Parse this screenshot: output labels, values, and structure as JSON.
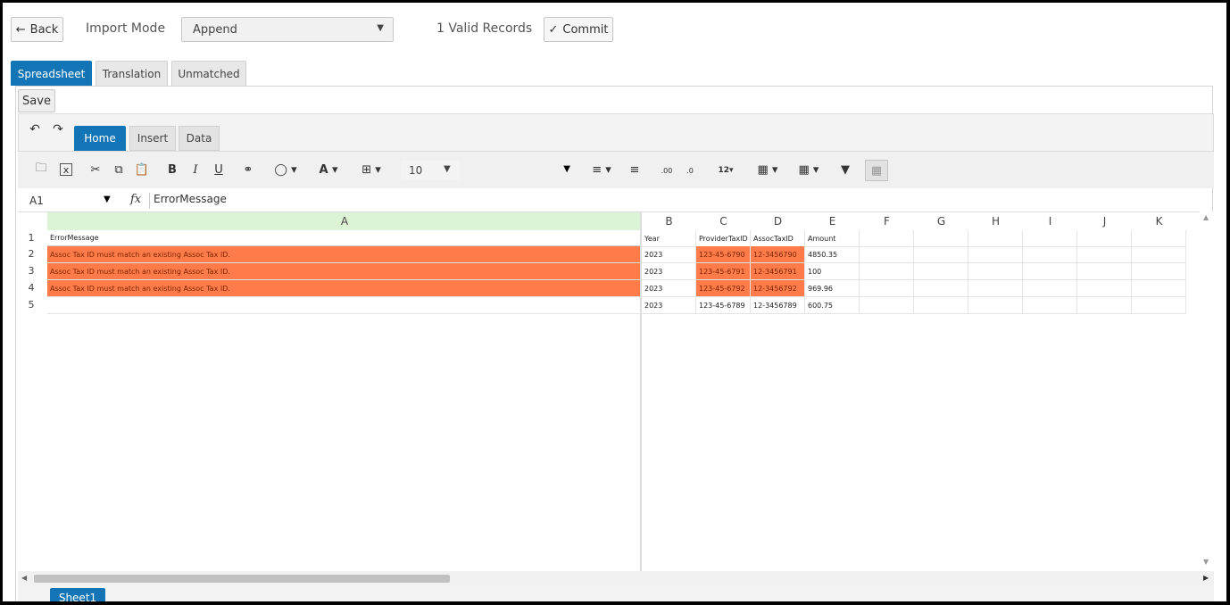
{
  "toolbar": {
    "back_label": "Back",
    "import_mode_label": "Import Mode",
    "import_mode_value": "Append",
    "valid_records_text": "1 Valid Records",
    "commit_label": "Commit"
  },
  "main_tabs": [
    "Spreadsheet",
    "Translation",
    "Unmatched"
  ],
  "save_label": "Save",
  "ribbon_tabs": [
    "Home",
    "Insert",
    "Data"
  ],
  "font_size": "10",
  "formula_bar": {
    "cell_ref": "A1",
    "fx": "fx",
    "formula": "ErrorMessage"
  },
  "columns": [
    "A",
    "B",
    "C",
    "D",
    "E",
    "F",
    "G",
    "H",
    "I",
    "J",
    "K"
  ],
  "rows": [
    [
      "ErrorMessage",
      "Year",
      "ProviderTaxID",
      "AssocTaxID",
      "Amount"
    ],
    [
      "Assoc Tax ID must match an existing Assoc Tax ID.",
      "2023",
      "123-45-6790",
      "12-3456790",
      "4850.35"
    ],
    [
      "Assoc Tax ID must match an existing Assoc Tax ID.",
      "2023",
      "123-45-6791",
      "12-3456791",
      "100"
    ],
    [
      "Assoc Tax ID must match an existing Assoc Tax ID.",
      "2023",
      "123-45-6792",
      "12-3456792",
      "969.96"
    ],
    [
      "",
      "2023",
      "123-45-6789",
      "12-3456789",
      "600.75"
    ]
  ],
  "row_numbers": [
    "1",
    "2",
    "3",
    "4",
    "5"
  ],
  "sheet_tab": "Sheet1",
  "colors": {
    "accent": "#1375b5",
    "error": "#ff7c4a",
    "header_selected": "#dcf3d5"
  }
}
